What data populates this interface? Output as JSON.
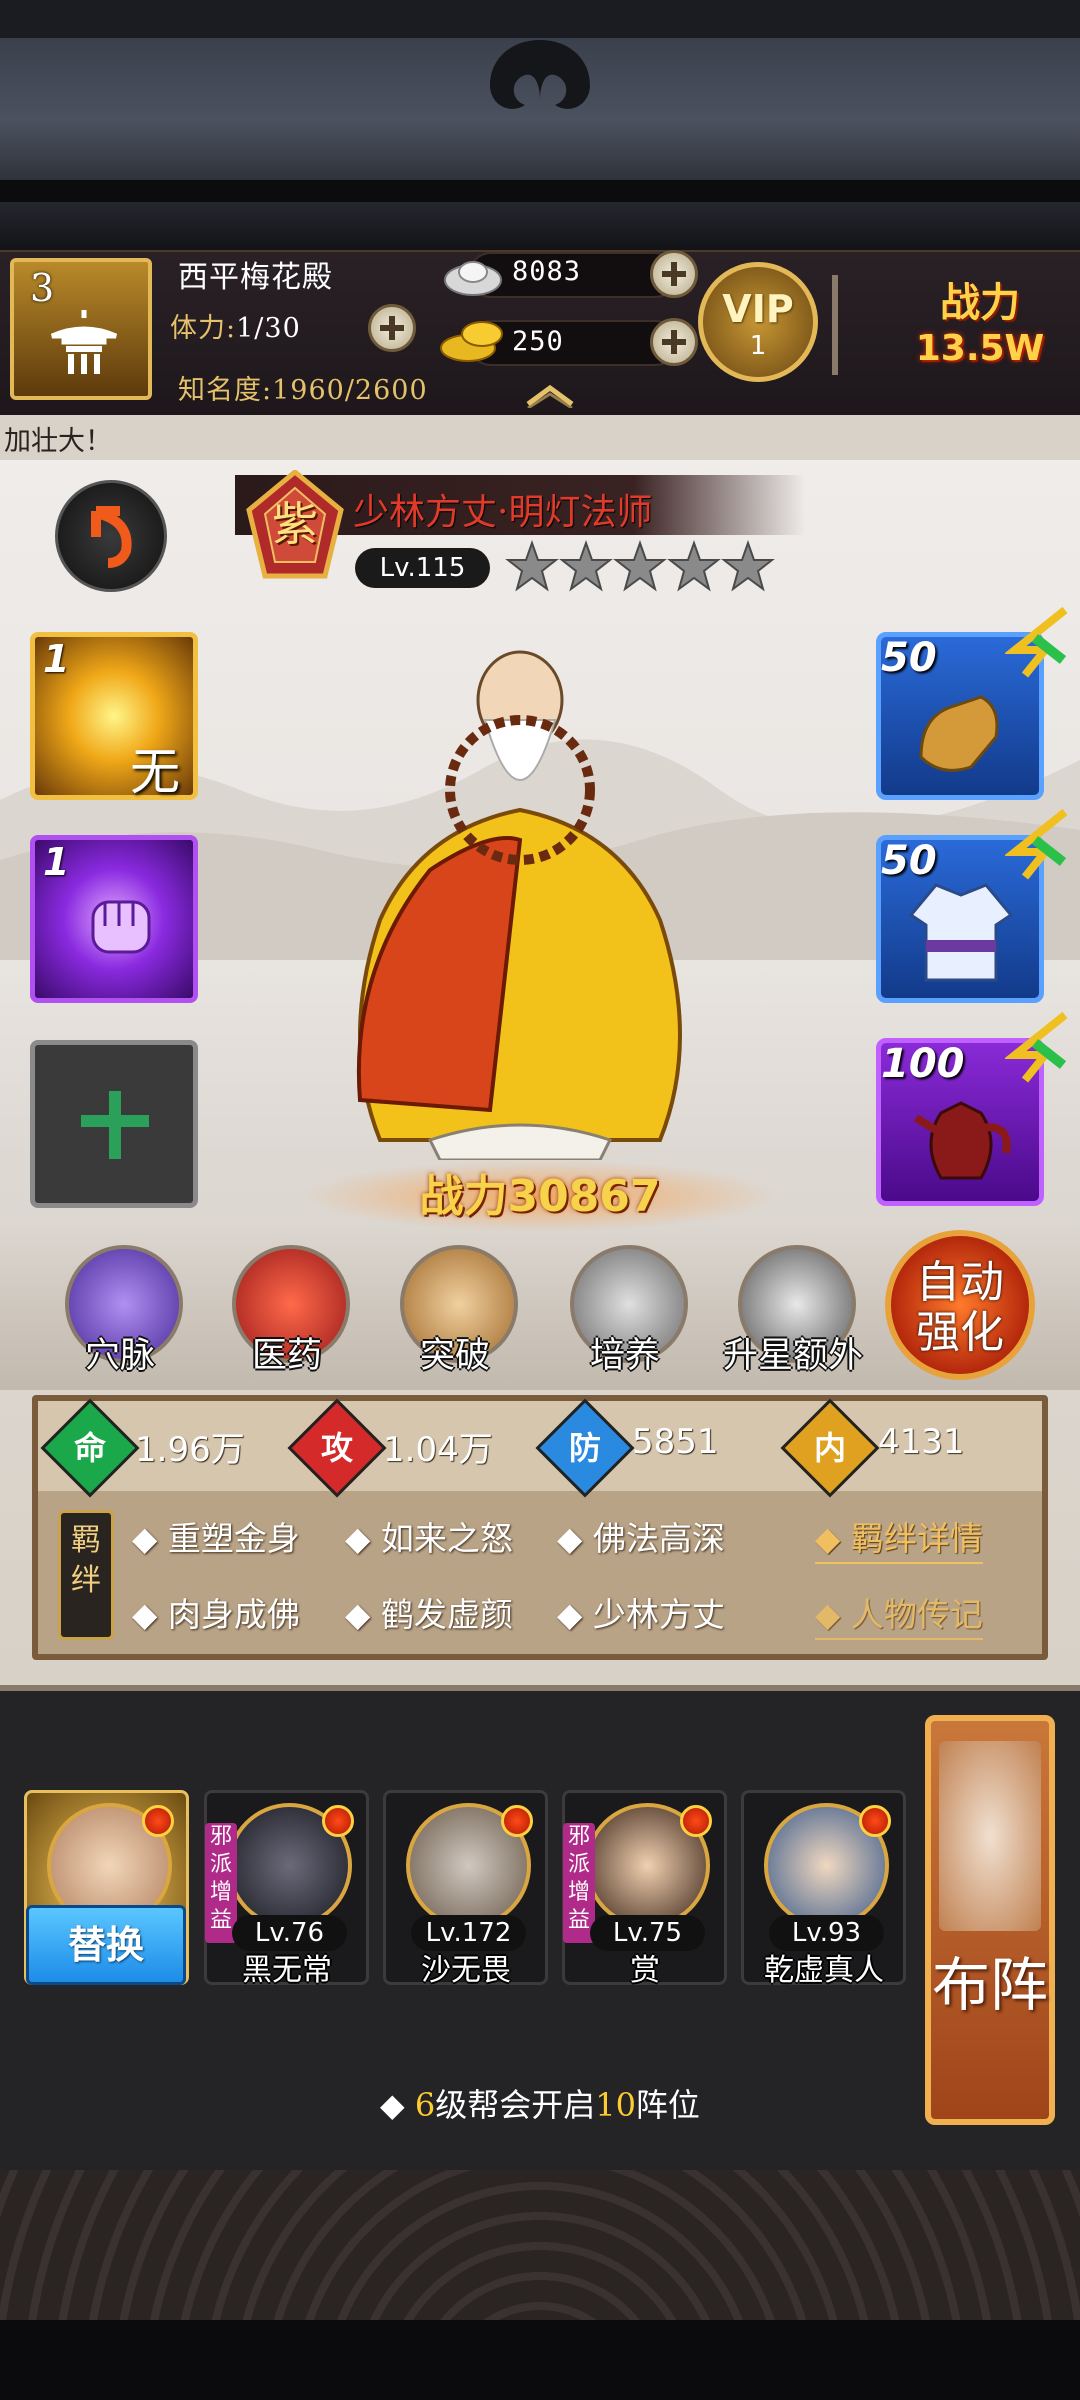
{
  "header": {
    "player_level": "3",
    "location": "西平梅花殿",
    "stamina_label": "体力:",
    "stamina_value": "1/30",
    "fame_label": "知名度:",
    "fame_value": "1960/2600",
    "silver": "8083",
    "gold": "250",
    "vip_label": "VIP",
    "vip_level": "1",
    "power_label": "战力",
    "power_value": "13.5W"
  },
  "ticker": {
    "text": "加壮大！"
  },
  "hero": {
    "rank_glyph": "紫",
    "name": "少林方丈·明灯法师",
    "level": "Lv.115",
    "stars": 5,
    "power_label": "战力",
    "power_value": "30867"
  },
  "skills": [
    {
      "level": "1",
      "glyph": "无",
      "color": "#f6b418"
    },
    {
      "level": "1",
      "color": "#9a3ae0"
    },
    {
      "icon": "plus-icon"
    }
  ],
  "equipment": [
    {
      "level": "50",
      "item": "gloves"
    },
    {
      "level": "50",
      "item": "robe"
    },
    {
      "level": "100",
      "item": "teapot"
    }
  ],
  "nav": {
    "meridian": "穴脉",
    "medicine": "医药",
    "breakthrough": "突破",
    "cultivate": "培养",
    "star_up": "升星额外",
    "auto_strengthen": "自动强化"
  },
  "stats": {
    "hp_label": "命",
    "hp_value": "1.96万",
    "atk_label": "攻",
    "atk_value": "1.04万",
    "def_label": "防",
    "def_value": "5851",
    "inner_label": "内",
    "inner_value": "4131"
  },
  "bonds": {
    "tag": "羁绊",
    "items": [
      "重塑金身",
      "如来之怒",
      "佛法高深",
      "肉身成佛",
      "鹤发虚颜",
      "少林方丈"
    ],
    "detail_link": "羁绊详情",
    "bio_link": "人物传记"
  },
  "lineup": {
    "replace_label": "替换",
    "evil_tag": "邪派增益",
    "heroes": [
      {
        "level": "Lv.76",
        "name": "黑无常"
      },
      {
        "level": "Lv.172",
        "name": "沙无畏"
      },
      {
        "level": "Lv.75",
        "name": "赏"
      },
      {
        "level": "Lv.93",
        "name": "乾虚真人"
      }
    ],
    "formation_label": "布阵",
    "hint_prefix": "◆",
    "hint_num1": "6",
    "hint_mid": "级帮会开启",
    "hint_num2": "10",
    "hint_suffix": "阵位"
  },
  "colors": {
    "gold": "#e4c16a",
    "hp": "#1aa84a",
    "atk": "#d42a2a",
    "def": "#2a8ae0",
    "inner": "#e0a020"
  }
}
